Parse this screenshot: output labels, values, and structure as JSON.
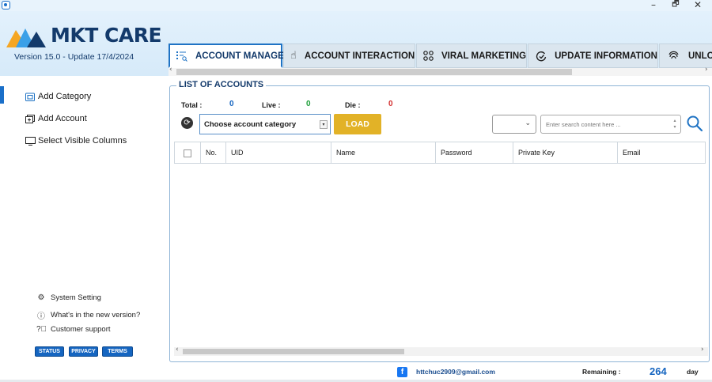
{
  "window": {
    "minimize": "–",
    "maximize": "🗗",
    "close": "✕"
  },
  "brand": {
    "name": "MKT CARE",
    "version_text": "Version  15.0  - Update  17/4/2024",
    "colors": {
      "primary": "#133a6b",
      "accent": "#f5a623",
      "logo_blue": "#3aa0e8"
    }
  },
  "tabs": [
    {
      "label": "ACCOUNT MANAGE",
      "icon": "list-search-icon",
      "active": true
    },
    {
      "label": "ACCOUNT INTERACTION",
      "icon": "pointer-icon",
      "active": false
    },
    {
      "label": "VIRAL MARKETING",
      "icon": "share-nodes-icon",
      "active": false
    },
    {
      "label": "UPDATE INFORMATION",
      "icon": "refresh-check-icon",
      "active": false
    },
    {
      "label": "UNLO",
      "icon": "fingerprint-icon",
      "active": false
    }
  ],
  "sidebar": {
    "items": [
      {
        "label": "Add Category",
        "icon": "folder-add-icon"
      },
      {
        "label": "Add Account",
        "icon": "account-add-icon"
      },
      {
        "label": "Select Visible Columns",
        "icon": "monitor-icon"
      }
    ],
    "links": [
      {
        "label": "System Setting",
        "icon": "gear-icon"
      },
      {
        "label": "What's in the new version?",
        "icon": "info-icon"
      },
      {
        "label": "Customer support",
        "icon": "help-icon"
      }
    ],
    "buttons": [
      "STATUS",
      "PRIVACY",
      "TERMS"
    ]
  },
  "main": {
    "title": "LIST OF ACCOUNTS",
    "stats": {
      "total_label": "Total :",
      "total_value": "0",
      "live_label": "Live :",
      "live_value": "0",
      "die_label": "Die :",
      "die_value": "0",
      "colors": {
        "total": "#1565c0",
        "live": "#1e9e3a",
        "die": "#d32f2f"
      }
    },
    "category_select": "Choose account category",
    "load_label": "LOAD",
    "search_placeholder": "Enter search content here ...",
    "columns": [
      "No.",
      "UID",
      "Name",
      "Password",
      "Private Key",
      "Email"
    ]
  },
  "footer": {
    "email": "httchuc2909@gmail.com",
    "remaining_label": "Remaining :",
    "remaining_value": "264",
    "remaining_unit": "day"
  }
}
